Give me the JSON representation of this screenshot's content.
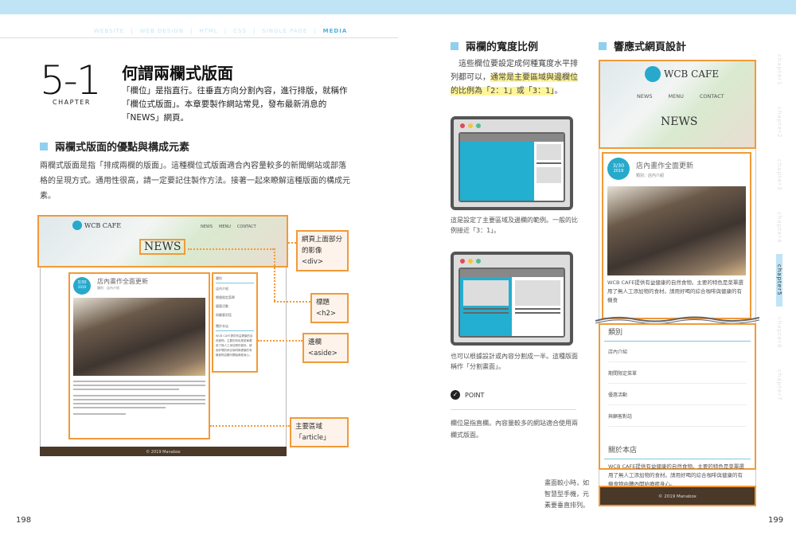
{
  "breadcrumb": [
    "WEBSITE",
    "WEB DESIGN",
    "HTML",
    "CSS",
    "SINGLE PAGE",
    "MEDIA"
  ],
  "chapter": {
    "number": "5-1",
    "label": "CHAPTER"
  },
  "title": "何謂兩欄式版面",
  "lead": "「欄位」是指直行。往垂直方向分割內容，進行排版，就稱作「欄位式版面」。本章要製作網站常見，發布最新消息的「NEWS」網頁。",
  "section1": {
    "heading": "兩欄式版面的優點與構成元素",
    "body": "兩欄式版面是指「排成兩欄的版面」。這種欄位式版面適合內容量較多的新聞網站或部落格的呈現方式。通用性很高，請一定要記住製作方法。接著一起來瞭解這種版面的構成元素。"
  },
  "mock": {
    "logo": "WCB CAFE",
    "nav": [
      "NEWS",
      "MENU",
      "CONTACT"
    ],
    "hero_title": "NEWS",
    "date": "3/30",
    "year": "2019",
    "post_title": "店內畫作全面更新",
    "post_category": "類別：店內介紹",
    "post_text": "WCB CAFE提供有益健康的自然食物。主要的特色是菜單選用了無人工添加物的食材。請用好喝的綜合咖啡與健康的有機食",
    "aside_heading1": "類別",
    "aside_items": [
      "店內介紹",
      "期間限定菜單",
      "優惠活動",
      "與顧客對話"
    ],
    "aside_heading2": "關於本店",
    "aside_text": "WCB CAFE提供有益健康的自然食物。主要的特色是菜單選用了無人工添加物的食材。請用好喝的綜合咖啡與健康的有機食物由體內開始療癒身心。",
    "footer": "© 2019 Manabox"
  },
  "callouts": {
    "hero": "網頁上面部分的影像 <div>",
    "heading": "標題 <h2>",
    "aside": "邊欄 <aside>",
    "article": "主要區域「article」"
  },
  "section2": {
    "heading": "兩欄的寬度比例",
    "body_plain": "這些欄位要設定成何種寬度水平排列都可以，",
    "body_highlight": "通常是主要區域與邊欄位的比例為「2：1」或「3：1」",
    "body_end": "。",
    "caption1": "這是設定了主要區域及邊欄的範例。一般的比例接近「3：1」。",
    "caption2": "也可以根據設計或內容分割成一半。這種版面稱作「分割畫面」。"
  },
  "point": {
    "label": "POINT",
    "text": "欄位是指直欄。內容量較多的網站適合使用兩欄式版面。"
  },
  "section3": {
    "heading": "響應式網頁設計",
    "note": "畫面較小時，如智慧型手機，元素要垂直排列。"
  },
  "side_tabs": [
    "chapter1",
    "chapter2",
    "chapter3",
    "chapter4",
    "chapter5",
    "chapter6",
    "chapter7"
  ],
  "active_tab": "chapter5",
  "page_numbers": {
    "left": "198",
    "right": "199"
  },
  "colors": {
    "accent": "#8fd0f0",
    "callout": "#f19a38",
    "highlight": "#fff59a",
    "date_badge": "#27a9cc"
  }
}
